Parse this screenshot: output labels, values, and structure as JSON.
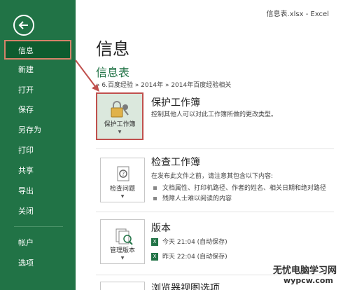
{
  "window": {
    "file_title": "信息表.xlsx - Excel"
  },
  "sidebar": {
    "items": [
      {
        "label": "信息"
      },
      {
        "label": "新建"
      },
      {
        "label": "打开"
      },
      {
        "label": "保存"
      },
      {
        "label": "另存为"
      },
      {
        "label": "打印"
      },
      {
        "label": "共享"
      },
      {
        "label": "导出"
      },
      {
        "label": "关闭"
      },
      {
        "label": "帐户"
      },
      {
        "label": "选项"
      }
    ]
  },
  "main": {
    "title": "信息",
    "doc_name": "信息表",
    "breadcrumb": "» 6.百度经验 » 2014年 » 2014年百度经验相关",
    "protect": {
      "tile_label": "保护工作簿",
      "title": "保护工作簿",
      "desc": "控制其他人可以对此工作簿所做的更改类型。"
    },
    "inspect": {
      "tile_label": "检查问题",
      "title": "检查工作簿",
      "desc": "在发布此文件之前，请注意其包含以下内容:",
      "bullets": [
        "文档属性、打印机路径、作者的姓名、相关日期和绝对路径",
        "残障人士难以阅读的内容"
      ]
    },
    "versions": {
      "tile_label": "管理版本",
      "title": "版本",
      "entries": [
        "今天 21:04 (自动保存)",
        "昨天 22:04 (自动保存)"
      ]
    },
    "browser": {
      "title": "浏览器视图选项"
    }
  },
  "watermark": {
    "line1": "无忧电脑学习网",
    "line2": "wypcw.com"
  },
  "colors": {
    "sidebar": "#217346",
    "active": "#0e5c2f",
    "highlight": "#c0504d",
    "accent": "#217346"
  }
}
